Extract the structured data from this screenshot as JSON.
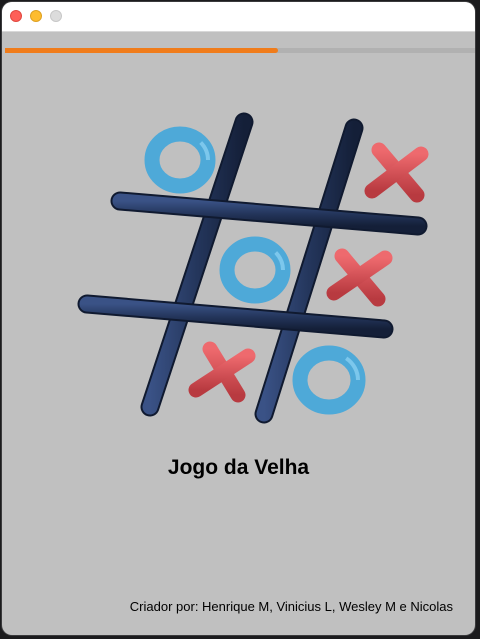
{
  "window": {
    "controls": [
      "close-icon",
      "minimize-icon",
      "maximize-icon"
    ]
  },
  "progress": {
    "value_percent": 58,
    "fill_color": "#f07c1b"
  },
  "logo": {
    "name": "tic-tac-toe-3d-logo",
    "grid_color": "#24365c",
    "o_color": "#4ea9d8",
    "x_color": "#d84a4f"
  },
  "main": {
    "title": "Jogo da Velha"
  },
  "footer": {
    "credits": "Criador por: Henrique M, Vinicius L, Wesley M e Nicolas"
  }
}
